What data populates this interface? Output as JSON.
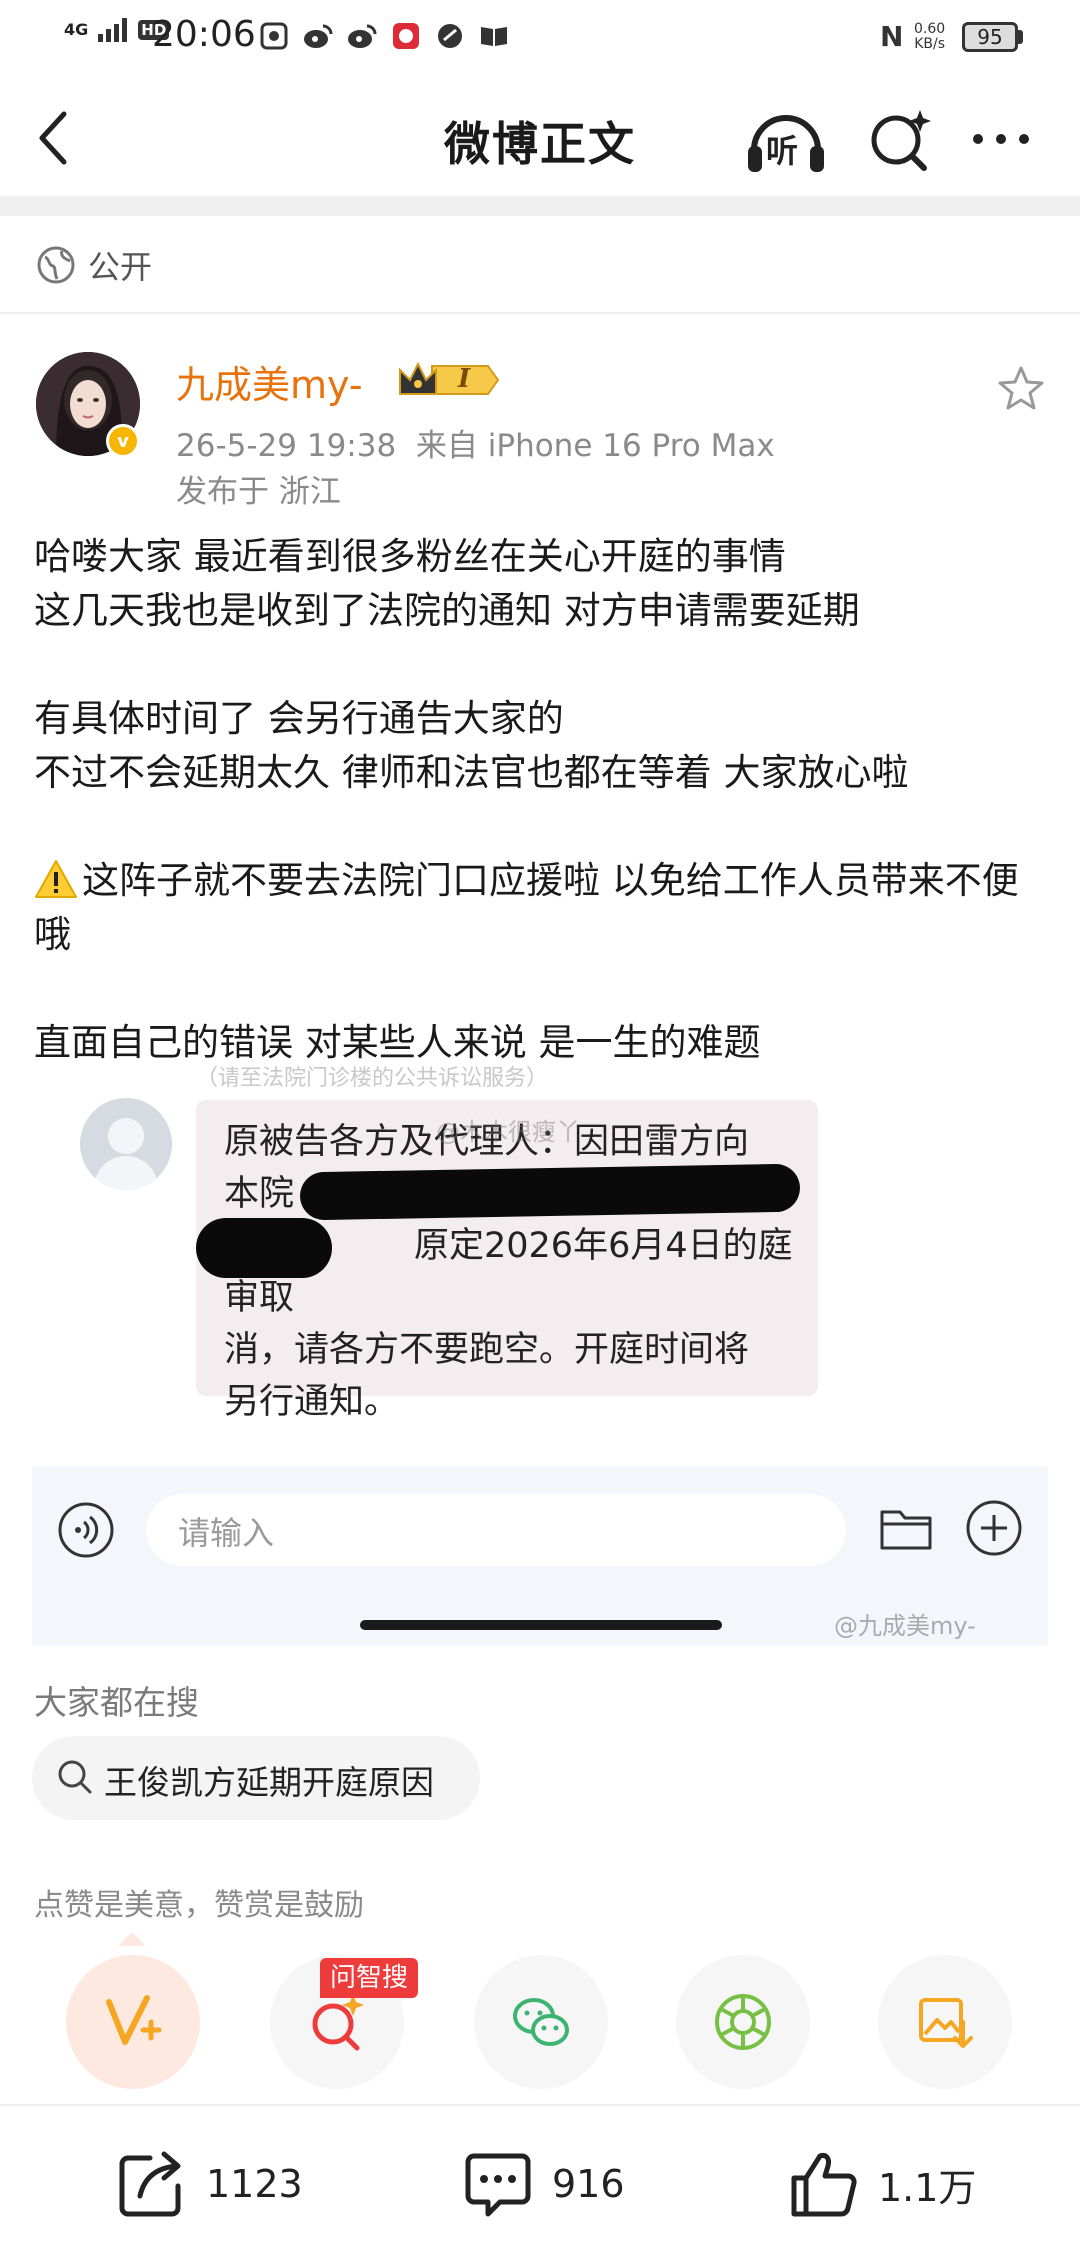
{
  "status_bar": {
    "time": "20:06",
    "network": "4G",
    "hd": "HD",
    "net_speed_value": "0.60",
    "net_speed_unit": "KB/s",
    "battery": "95",
    "nfc": "N"
  },
  "header": {
    "title": "微博正文",
    "listen_label": "听"
  },
  "visibility": {
    "label": "公开"
  },
  "post": {
    "author": "九成美my-",
    "vip_level": "I",
    "verified_mark": "v",
    "timestamp": "26-5-29 19:38",
    "source": "来自 iPhone 16 Pro Max",
    "location": "发布于 浙江",
    "paragraphs": [
      "哈喽大家 最近看到很多粉丝在关心开庭的事情",
      "这几天我也是收到了法院的通知 对方申请需要延期",
      "有具体时间了 会另行通告大家的",
      "不过不会延期太久 律师和法官也都在等着 大家放心啦",
      "这阵子就不要去法院门口应援啦 以免给工作人员带来不便哦",
      "直面自己的错误 对某些人来说 是一生的难题"
    ]
  },
  "embedded_image": {
    "faint_header": "（请至法院门诊楼的公共诉讼服务）",
    "watermark_top": "@木木很瘦丫",
    "message_line1": "原被告各方及代理人：因田雷方向",
    "message_line2": "本院",
    "message_line3": "原定2026年6月4日的庭审取",
    "message_line4": "消，请各方不要跑空。开庭时间将",
    "message_line5": "另行通知。",
    "input_placeholder": "请输入",
    "watermark_bottom": "@九成美my-"
  },
  "search": {
    "heading": "大家都在搜",
    "suggestion": "王俊凯方延期开庭原因"
  },
  "reward": {
    "caption": "点赞是美意，赞赏是鼓励",
    "ai_badge": "问智搜"
  },
  "actions": {
    "share_count": "1123",
    "comment_count": "916",
    "like_count": "1.1万"
  },
  "colors": {
    "author_orange": "#e8720c",
    "badge_red": "#ee3b3b",
    "wechat_green": "#3cb371",
    "moments_green": "#77c043",
    "reward_orange": "#f5a623"
  }
}
